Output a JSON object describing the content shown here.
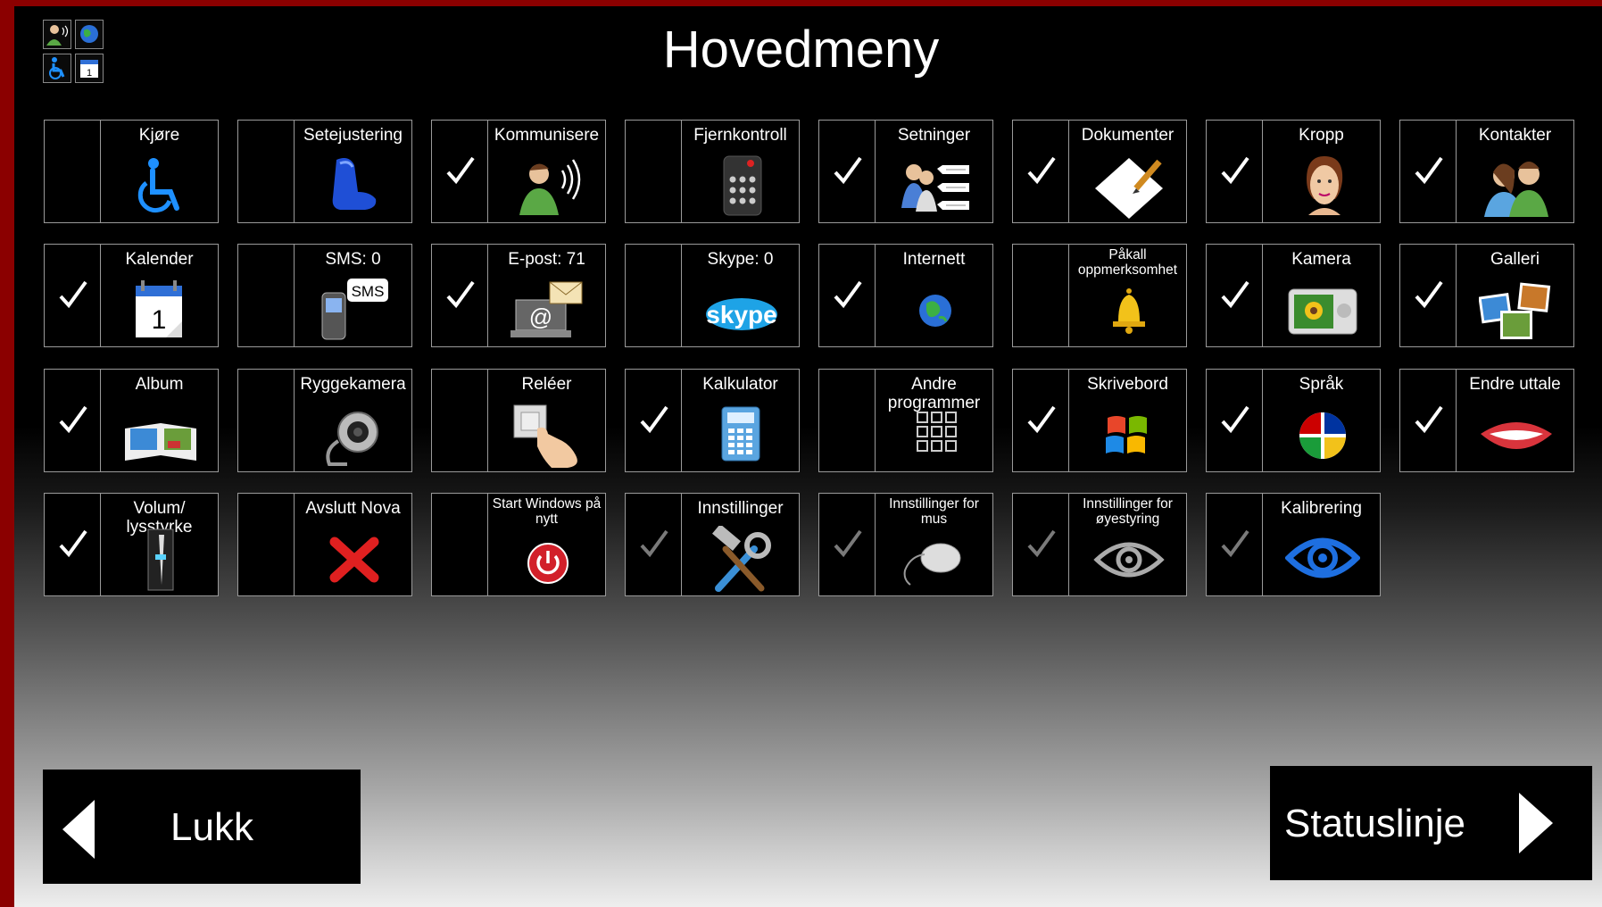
{
  "header": {
    "title": "Hovedmeny",
    "mini_icons": [
      "communicate-icon",
      "globe-icon",
      "wheelchair-icon",
      "calendar-icon"
    ]
  },
  "tiles": [
    {
      "label": "Kjøre",
      "checked": false,
      "icon": "wheelchair-icon"
    },
    {
      "label": "Setejustering",
      "checked": false,
      "icon": "seat-icon"
    },
    {
      "label": "Kommunisere",
      "checked": true,
      "icon": "communicate-icon"
    },
    {
      "label": "Fjernkontroll",
      "checked": false,
      "icon": "remote-control-icon"
    },
    {
      "label": "Setninger",
      "checked": true,
      "icon": "sentences-icon"
    },
    {
      "label": "Dokumenter",
      "checked": true,
      "icon": "document-pencil-icon"
    },
    {
      "label": "Kropp",
      "checked": true,
      "icon": "head-icon"
    },
    {
      "label": "Kontakter",
      "checked": true,
      "icon": "contacts-icon"
    },
    {
      "label": "Kalender",
      "checked": true,
      "icon": "calendar-icon"
    },
    {
      "label": "SMS: 0",
      "checked": false,
      "icon": "sms-phone-icon"
    },
    {
      "label": "E-post: 71",
      "checked": true,
      "icon": "email-laptop-icon"
    },
    {
      "label": "Skype: 0",
      "checked": false,
      "icon": "skype-icon"
    },
    {
      "label": "Internett",
      "checked": true,
      "icon": "globe-icon"
    },
    {
      "label": "Påkall oppmerksomhet",
      "checked": false,
      "icon": "bell-icon"
    },
    {
      "label": "Kamera",
      "checked": true,
      "icon": "camera-icon"
    },
    {
      "label": "Galleri",
      "checked": true,
      "icon": "gallery-icon"
    },
    {
      "label": "Album",
      "checked": true,
      "icon": "photo-album-icon"
    },
    {
      "label": "Ryggekamera",
      "checked": false,
      "icon": "webcam-icon"
    },
    {
      "label": "Reléer",
      "checked": false,
      "icon": "relay-switch-icon"
    },
    {
      "label": "Kalkulator",
      "checked": true,
      "icon": "calculator-icon"
    },
    {
      "label": "Andre programmer",
      "checked": false,
      "icon": "app-grid-icon"
    },
    {
      "label": "Skrivebord",
      "checked": true,
      "icon": "windows-logo-icon"
    },
    {
      "label": "Språk",
      "checked": true,
      "icon": "language-flags-icon"
    },
    {
      "label": "Endre uttale",
      "checked": true,
      "icon": "mouth-icon"
    },
    {
      "label": "Volum/ lysstyrke",
      "checked": true,
      "icon": "slider-icon"
    },
    {
      "label": "Avslutt Nova",
      "checked": false,
      "icon": "close-x-icon"
    },
    {
      "label": "Start Windows på nytt",
      "checked": false,
      "icon": "power-icon"
    },
    {
      "label": "Innstillinger",
      "checked": "dimmed",
      "icon": "tools-icon"
    },
    {
      "label": "Innstillinger for mus",
      "checked": "dimmed",
      "icon": "mouse-icon"
    },
    {
      "label": "Innstillinger for øyestyring",
      "checked": "dimmed",
      "icon": "eye-gray-icon"
    },
    {
      "label": "Kalibrering",
      "checked": "dimmed",
      "icon": "eye-blue-icon"
    }
  ],
  "footer": {
    "close_label": "Lukk",
    "status_label": "Statuslinje"
  },
  "colors": {
    "frame": "#8b0000",
    "tile_border": "#9a9a9a",
    "check": "#ffffff",
    "check_dimmed": "#7a7a7a"
  }
}
